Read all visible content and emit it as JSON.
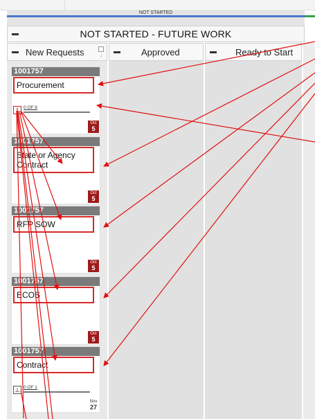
{
  "status": {
    "label": "NOT STARTED"
  },
  "lane": {
    "title": "NOT STARTED - FUTURE WORK"
  },
  "columns": [
    {
      "label": "New Requests"
    },
    {
      "label": "Approved"
    },
    {
      "label": "Ready to Start"
    }
  ],
  "cards": [
    {
      "id": "1001757",
      "name": "Procurement",
      "progress": "0 OF 6",
      "progress_value": 0,
      "date_month": "Oct",
      "date_day": "5"
    },
    {
      "id": "1001757",
      "name": "State or Agency Contract",
      "date_month": "Oct",
      "date_day": "5"
    },
    {
      "id": "1001757",
      "name": "RFP SOW",
      "date_month": "Oct",
      "date_day": "5"
    },
    {
      "id": "1001757",
      "name": "ECOS",
      "date_month": "Oct",
      "date_day": "5"
    },
    {
      "id": "1001757",
      "name": "Contract",
      "progress": "0 OF 1",
      "progress_value": 0,
      "date_month": "Nov",
      "date_day": "27"
    }
  ],
  "colors": {
    "accent_blue": "#4a77c9",
    "accent_green": "#3aa047",
    "date_red": "#9e1b1b",
    "annotation_red": "#e01010"
  }
}
